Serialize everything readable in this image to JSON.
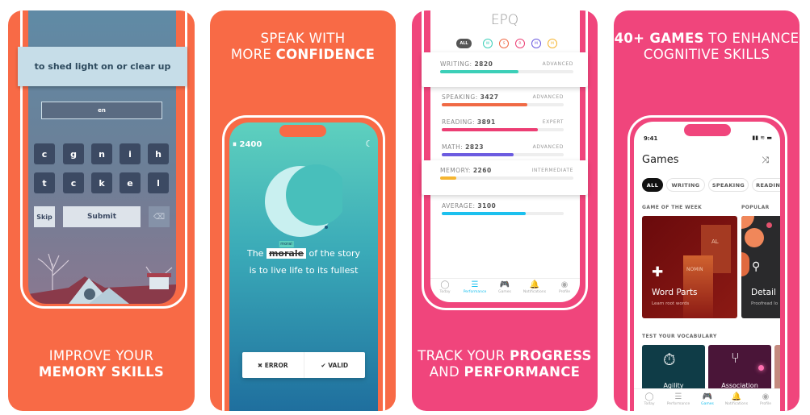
{
  "colors": {
    "orange": "#F86A46",
    "pink": "#F0457C",
    "teal": "#5ED0BE",
    "dark_blue": "#1F6F9E"
  },
  "panel1": {
    "definition": "to shed light on or clear up",
    "answer_value": "en",
    "keys": [
      [
        "c",
        "g",
        "n",
        "i",
        "h"
      ],
      [
        "t",
        "c",
        "k",
        "e",
        "l"
      ]
    ],
    "skip_label": "Skip",
    "submit_label": "Submit",
    "backspace_icon": "backspace-icon",
    "caption_line1": "IMPROVE YOUR",
    "caption_line2": "MEMORY SKILLS"
  },
  "panel2": {
    "heading_line1": "SPEAK WITH",
    "heading_line2_light": "MORE ",
    "heading_line2_bold": "CONFIDENCE",
    "score": "2400",
    "sentence_start": "The ",
    "wrong_word": "morale",
    "correction": "moral",
    "sentence_rest": " of the story",
    "sentence_line2": "is to live life to its fullest",
    "error_label": "ERROR",
    "valid_label": "VALID"
  },
  "panel3": {
    "title": "EPQ",
    "filters": [
      {
        "label": "ALL",
        "color": "#555555"
      },
      {
        "label": "W",
        "color": "#3CCFB8"
      },
      {
        "label": "S",
        "color": "#F06A45"
      },
      {
        "label": "R",
        "color": "#EC3E74"
      },
      {
        "label": "M",
        "color": "#6B5BE0"
      },
      {
        "label": "M",
        "color": "#F5B530"
      }
    ],
    "stats": [
      {
        "name": "WRITING: ",
        "value": "2820",
        "level": "ADVANCED",
        "fill": 0.59,
        "color": "#3CCFB8"
      },
      {
        "name": "SPEAKING: ",
        "value": "3427",
        "level": "ADVANCED",
        "fill": 0.7,
        "color": "#F06A45"
      },
      {
        "name": "READING: ",
        "value": "3891",
        "level": "EXPERT",
        "fill": 0.79,
        "color": "#EC3E74"
      },
      {
        "name": "MATH: ",
        "value": "2823",
        "level": "ADVANCED",
        "fill": 0.59,
        "color": "#6B5BE0"
      },
      {
        "name": "MEMORY: ",
        "value": "2260",
        "level": "INTERMEDIATE",
        "fill": 0.12,
        "color": "#F5B530"
      },
      {
        "name": "AVERAGE: ",
        "value": "3100",
        "level": "",
        "fill": 0.69,
        "color": "#1CC0EE"
      }
    ],
    "nav": [
      "Today",
      "Performance",
      "Games",
      "Notifications",
      "Profile"
    ],
    "nav_active": 1,
    "caption_line1_light": "TRACK YOUR ",
    "caption_line1_bold": "PROGRESS",
    "caption_line2_light": "AND ",
    "caption_line2_bold": "PERFORMANCE"
  },
  "panel4": {
    "heading_line1_bold": "40+ GAMES",
    "heading_line1_light": " TO ENHANCE",
    "heading_line2": "COGNITIVE SKILLS",
    "time": "9:41",
    "title": "Games",
    "chips": [
      "ALL",
      "WRITING",
      "SPEAKING",
      "READING"
    ],
    "game_of_week_label": "GAME OF THE WEEK",
    "popular_label": "POPULAR",
    "featured": {
      "title": "Word Parts",
      "subtitle": "Learn root words",
      "tile1": "AL",
      "tile2": "NOMIN"
    },
    "popular": {
      "title": "Detail",
      "subtitle": "Proofread lo"
    },
    "vocab_label": "TEST YOUR VOCABULARY",
    "vocab_games": [
      "Agility",
      "Association"
    ],
    "nav": [
      "Today",
      "Performance",
      "Games",
      "Notifications",
      "Profile"
    ],
    "nav_active": 2
  }
}
